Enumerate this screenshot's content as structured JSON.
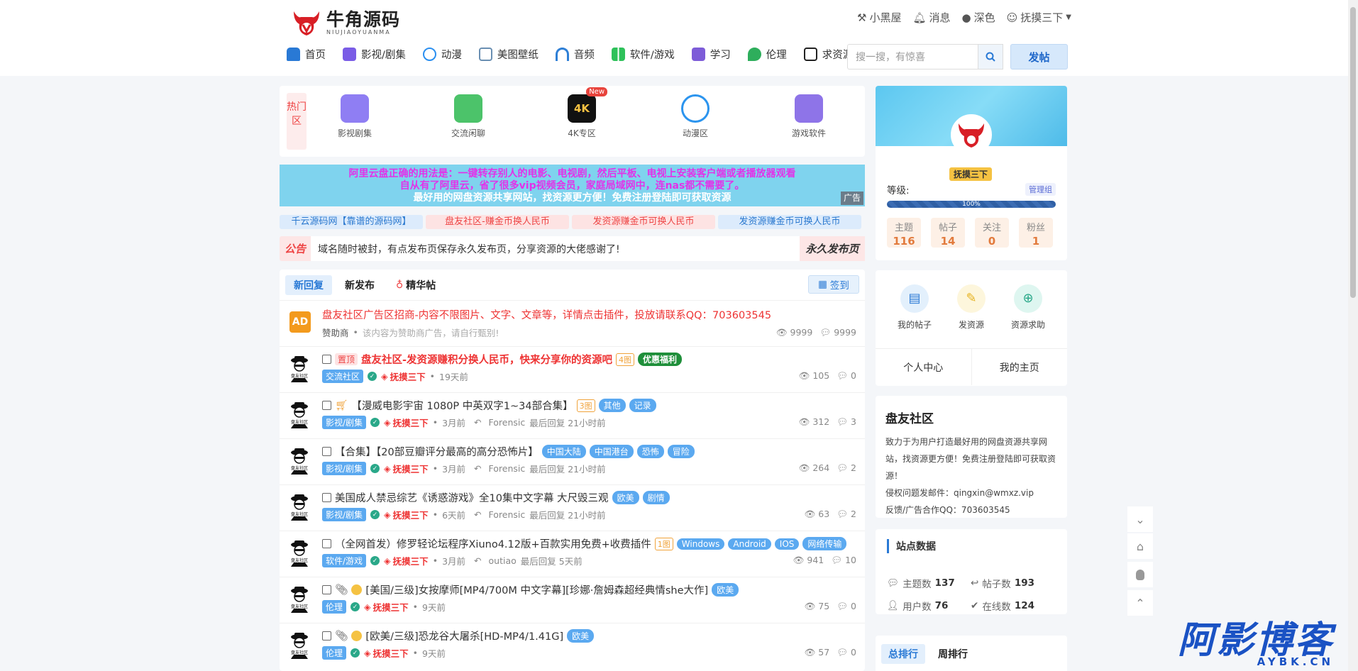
{
  "site": {
    "logo_cn": "牛角源码",
    "logo_en": "NIUJIAOYUANMA"
  },
  "toplinks": [
    {
      "label": "小黑屋",
      "icon": "hammer-icon"
    },
    {
      "label": "消息",
      "icon": "bell-icon"
    },
    {
      "label": "深色",
      "icon": "moon-icon"
    },
    {
      "label": "抚摸三下",
      "icon": "user-icon"
    }
  ],
  "nav": [
    {
      "label": "首页",
      "color": "#2979d5"
    },
    {
      "label": "影视/剧集",
      "color": "#7a5ce6"
    },
    {
      "label": "动漫",
      "color": "#2b8ff0"
    },
    {
      "label": "美图壁纸",
      "color": "#6a8fb2"
    },
    {
      "label": "音频",
      "color": "#2e7fd6"
    },
    {
      "label": "软件/游戏",
      "color": "#2ec15a"
    },
    {
      "label": "学习",
      "color": "#7d5cd8"
    },
    {
      "label": "伦理",
      "color": "#2eae5c"
    },
    {
      "label": "求资源",
      "color": "#222"
    }
  ],
  "search": {
    "placeholder": "搜一搜，有惊喜",
    "post_label": "发帖"
  },
  "hot": {
    "tag": "热门区",
    "items": [
      {
        "label": "影视剧集",
        "color": "#8f7ef3"
      },
      {
        "label": "交流闲聊",
        "color": "#4cc36a"
      },
      {
        "label": "4K专区",
        "color": "#111",
        "badge": "New",
        "icon_text": "4K"
      },
      {
        "label": "动漫区",
        "color": "#2b94ee"
      },
      {
        "label": "游戏软件",
        "color": "#8e74e8"
      }
    ]
  },
  "banner": {
    "line1": "阿里云盘正确的用法是：一键转存别人的电影、电视剧，然后平板、电视上安装客户端或者播放器观看",
    "line2": "自从有了阿里云，省了很多vip视频会员，家庭局域网中，连nas都不需要了。",
    "line3": "最好用的网盘资源共享网站，找资源更方便！免费注册登陆即可获取资源",
    "ad": "广告"
  },
  "links": [
    {
      "label": "千云源码网【靠谱的源码网】",
      "bg": "#dcebfc",
      "fg": "#2a78cf"
    },
    {
      "label": "盘友社区-赚金币换人民币",
      "bg": "#fde3e3",
      "fg": "#e44"
    },
    {
      "label": "发资源赚金币可换人民币",
      "bg": "#fde3e3",
      "fg": "#e44"
    },
    {
      "label": "发资源赚金币可换人民币",
      "bg": "#dcebfc",
      "fg": "#2a78cf"
    }
  ],
  "notice": {
    "label": "公告",
    "text": "域名随时被封，有点发布页保存永久发布页，分享资源的大佬感谢了!",
    "right": "永久发布页"
  },
  "tabs": [
    "新回复",
    "新发布",
    "精华帖"
  ],
  "signin": "签到",
  "ad_row": {
    "badge": "AD",
    "title": "盘友社区广告区招商-内容不限图片、文字、文章等，详情点击插件，投放请联系QQ：703603545",
    "sponsor": "赞助商",
    "desc": "该内容为赞助商广告，请自行甄别!",
    "views": "9999",
    "replies": "9999"
  },
  "rows": [
    {
      "top": "置顶",
      "title": "盘友社区-发资源赚积分换人民币，快来分享你的资源吧",
      "imgs": "4图",
      "tags": [
        "优惠福利"
      ],
      "cat": "交流社区",
      "user": "抚摸三下",
      "time": "19天前",
      "last": "",
      "last_time": "",
      "views": "105",
      "replies": "0"
    },
    {
      "cart": true,
      "title": "【漫威电影宇宙 1080P 中英双字1~34部合集】",
      "imgs": "3图",
      "tags": [
        "其他",
        "记录"
      ],
      "cat": "影视/剧集",
      "user": "抚摸三下",
      "time": "3月前",
      "last": "Forensic",
      "last_time": "最后回复 21小时前",
      "views": "312",
      "replies": "3"
    },
    {
      "title": "【合集】【20部豆瓣评分最高的高分恐怖片】",
      "imgs": "",
      "tags": [
        "中国大陆",
        "中国港台",
        "恐怖",
        "冒险"
      ],
      "cat": "影视/剧集",
      "user": "抚摸三下",
      "time": "3月前",
      "last": "Forensic",
      "last_time": "最后回复 21小时前",
      "views": "264",
      "replies": "2"
    },
    {
      "title": "美国成人禁忌综艺《诱惑游戏》全10集中文字幕 大尺毁三观",
      "imgs": "",
      "tags": [
        "欧美",
        "剧情"
      ],
      "cat": "影视/剧集",
      "user": "抚摸三下",
      "time": "6天前",
      "last": "Forensic",
      "last_time": "最后回复 21小时前",
      "views": "63",
      "replies": "2"
    },
    {
      "title": "（全网首发）修罗轻论坛程序Xiuno4.12版+百款实用免费+收费插件",
      "imgs": "1图",
      "tags": [
        "Windows",
        "Android",
        "IOS",
        "网络传输"
      ],
      "cat": "软件/游戏",
      "user": "抚摸三下",
      "time": "3月前",
      "last": "outiao",
      "last_time": "最后回复 5天前",
      "views": "941",
      "replies": "10"
    },
    {
      "clip": true,
      "coin": true,
      "title": "[美国/三级]女按摩师[MP4/700M 中文字幕][珍娜·詹姆森超经典情she大作]",
      "imgs": "",
      "tags": [
        "欧美"
      ],
      "cat": "伦理",
      "user": "抚摸三下",
      "time": "9天前",
      "last": "",
      "last_time": "",
      "views": "75",
      "replies": "0"
    },
    {
      "clip": true,
      "coin": true,
      "title": "[欧美/三级]恐龙谷大屠杀[HD-MP4/1.41G]",
      "imgs": "",
      "tags": [
        "欧美"
      ],
      "cat": "伦理",
      "user": "抚摸三下",
      "time": "9天前",
      "last": "",
      "last_time": "",
      "views": "57",
      "replies": "0"
    }
  ],
  "profile": {
    "name": "抚摸三下",
    "level_label": "等级:",
    "group": "管理组",
    "progress": "100%",
    "stats": [
      {
        "label": "主题",
        "value": "116"
      },
      {
        "label": "帖子",
        "value": "14"
      },
      {
        "label": "关注",
        "value": "0"
      },
      {
        "label": "粉丝",
        "value": "1"
      }
    ]
  },
  "quick": {
    "items": [
      {
        "label": "我的帖子",
        "color": "#e3f0fc"
      },
      {
        "label": "发资源",
        "color": "#fdf6dc"
      },
      {
        "label": "资源求助",
        "color": "#def6f0"
      }
    ],
    "links": [
      "个人中心",
      "我的主页"
    ]
  },
  "about": {
    "title": "盘友社区",
    "desc": "致力于为用户打造最好用的网盘资源共享网站，找资源更方便！免费注册登陆即可获取资源！",
    "email": "侵权问题发邮件：qingxin@wmxz.vip",
    "qq": "反馈/广告合作QQ：703603545"
  },
  "sitedata": {
    "title": "站点数据",
    "items": [
      {
        "label": "主题数",
        "value": "137"
      },
      {
        "label": "帖子数",
        "value": "193"
      },
      {
        "label": "用户数",
        "value": "76"
      },
      {
        "label": "在线数",
        "value": "124"
      }
    ]
  },
  "rank": {
    "tabs": [
      "总排行",
      "周排行"
    ]
  },
  "watermark": {
    "big": "阿影博客",
    "small": "AYBK.CN"
  }
}
